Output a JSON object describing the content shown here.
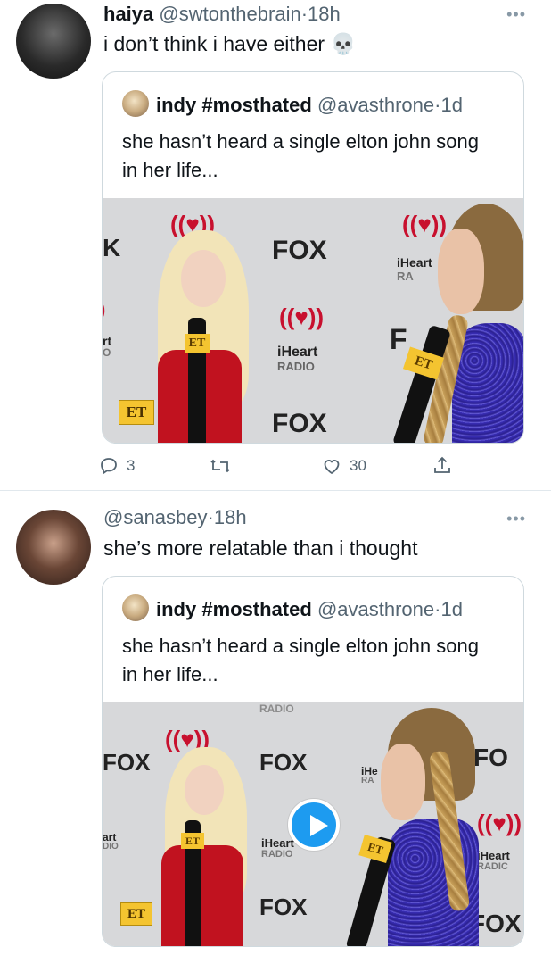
{
  "tweets": [
    {
      "name": "haiya",
      "handle": "@swtonthebrain",
      "time": "18h",
      "text": "i don’t think i have either",
      "emoji": "💀",
      "quote": {
        "name": "indy #mosthated",
        "handle": "@avasthrone",
        "time": "1d",
        "text": "she hasn’t heard a single elton john song in her life..."
      },
      "media": {
        "logos": [
          "FOX",
          "iHeart",
          "RADIO",
          "FOX",
          "ET",
          "ET",
          "ET",
          "iHeart",
          "RA",
          "rt",
          "O",
          "F"
        ]
      },
      "actions": {
        "replies": "3",
        "likes": "30"
      }
    },
    {
      "name": "",
      "handle": "@sanasbey",
      "time": "18h",
      "text": "she’s more relatable than i thought",
      "quote": {
        "name": "indy #mosthated",
        "handle": "@avasthrone",
        "time": "1d",
        "text": "she hasn’t heard a single elton john song in her life..."
      },
      "media": {
        "logos": [
          "RADIO",
          "FOX",
          "FOX",
          "FOX",
          "ET",
          "ET",
          "ET",
          "iHeart",
          "RADIO",
          "iHeart",
          "RADIC",
          "FO",
          "FOX",
          "art",
          "DIO",
          "iHe",
          "RA",
          "iH"
        ]
      }
    }
  ],
  "more_icon": "ellipsis-icon",
  "reply_icon": "reply-icon",
  "retweet_icon": "retweet-icon",
  "like_icon": "heart-icon",
  "share_icon": "share-icon",
  "play_icon": "play-icon",
  "colors": {
    "accent": "#1d9bf0",
    "muted": "#536471",
    "border": "#cfd9de"
  }
}
